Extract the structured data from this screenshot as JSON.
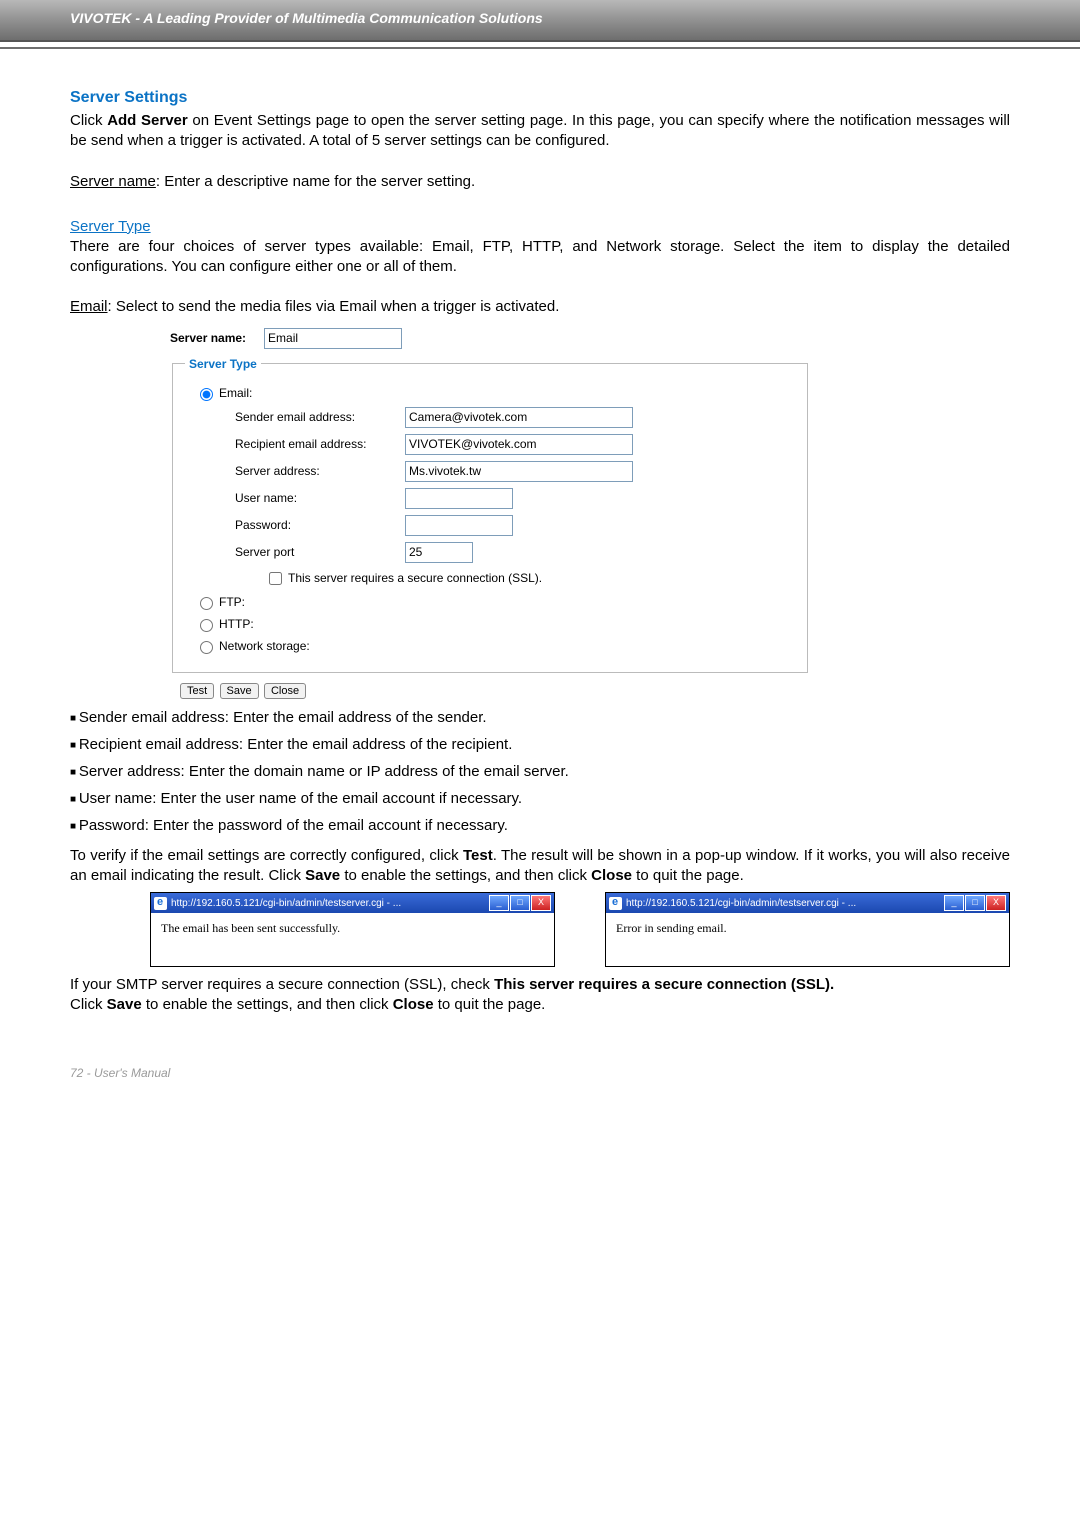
{
  "header": "VIVOTEK - A Leading Provider of Multimedia Communication Solutions",
  "section_title": "Server Settings",
  "intro_pre": "Click ",
  "intro_bold": "Add Server",
  "intro_post": " on Event Settings page to open the server setting page. In this page, you can specify where the notification messages will be send when a trigger is activated. A total of 5 server settings can be configured.",
  "server_name_label": "Server name",
  "server_name_desc": ": Enter a descriptive name for the server setting.",
  "server_type_heading": "Server Type",
  "server_type_desc": "There are four choices of server types available: Email, FTP, HTTP, and Network storage. Select the item to display the detailed configurations. You can configure either one or all of them.",
  "email_label": "Email",
  "email_desc": ": Select to send the media files via Email when a trigger is activated.",
  "form": {
    "server_name_label": "Server name:",
    "server_name_value": "Email",
    "fieldset_legend": "Server Type",
    "radio_email": "Email:",
    "radio_ftp": "FTP:",
    "radio_http": "HTTP:",
    "radio_network": "Network storage:",
    "sender_label": "Sender email address:",
    "sender_value": "Camera@vivotek.com",
    "recipient_label": "Recipient email address:",
    "recipient_value": "VIVOTEK@vivotek.com",
    "serveraddr_label": "Server address:",
    "serveraddr_value": "Ms.vivotek.tw",
    "username_label": "User name:",
    "username_value": "",
    "password_label": "Password:",
    "password_value": "",
    "port_label": "Server port",
    "port_value": "25",
    "ssl_label": "This server requires a secure connection (SSL).",
    "btn_test": "Test",
    "btn_save": "Save",
    "btn_close": "Close"
  },
  "bullets": {
    "b1": "Sender email address: Enter the email address of the sender.",
    "b2": "Recipient email address: Enter the email address of the recipient.",
    "b3": "Server address: Enter the domain name or IP address of the email server.",
    "b4": "User name: Enter the user name of the email account if necessary.",
    "b5": "Password: Enter the password of the email account if necessary."
  },
  "verify_a": "To verify if the email settings are correctly configured, click ",
  "verify_test": "Test",
  "verify_b": ". The result will be shown in a pop-up window. If it works, you will also receive an email indicating the result. Click ",
  "verify_save": "Save",
  "verify_c": " to enable the settings, and then click ",
  "verify_close": "Close",
  "verify_d": " to quit the page.",
  "popup1": {
    "url": "http://192.160.5.121/cgi-bin/admin/testserver.cgi - ...",
    "msg": "The email has been sent successfully."
  },
  "popup2": {
    "url": "http://192.160.5.121/cgi-bin/admin/testserver.cgi - ...",
    "msg": "Error in sending email."
  },
  "smtp_a": "If your SMTP server requires a secure connection (SSL), check ",
  "smtp_bold": "This server requires a secure connection (SSL).",
  "smtp_b": "Click ",
  "smtp_save": "Save",
  "smtp_c": " to enable the settings,  and then click ",
  "smtp_close": "Close",
  "smtp_d": " to quit the page.",
  "footer": "72 - User's Manual"
}
